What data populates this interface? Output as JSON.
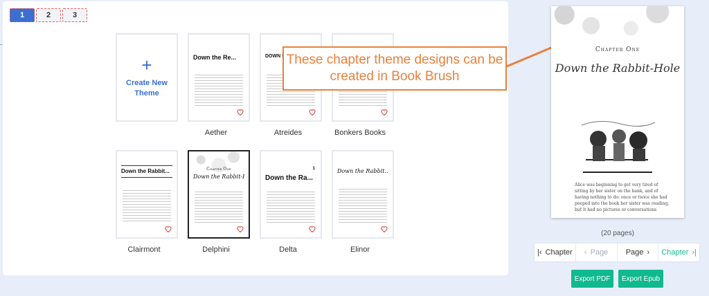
{
  "pagination": {
    "pages": [
      "1",
      "2",
      "3"
    ],
    "active": "1"
  },
  "themes": {
    "create_label": "Create New Theme",
    "create_plus": "+",
    "items": [
      {
        "name": "Aether",
        "title": "Down the Re..."
      },
      {
        "name": "Atreides",
        "title": "DOWN the"
      },
      {
        "name": "Bonkers Books",
        "title": ""
      },
      {
        "name": "Clairmont",
        "title": "Down the Rabbit..."
      },
      {
        "name": "Delphini",
        "chapter": "Chapter One",
        "title": "Down the Rabbit-Hole"
      },
      {
        "name": "Delta",
        "title": "Down the Ra...",
        "page": "1"
      },
      {
        "name": "Elinor",
        "title": "Down the Rabbit..."
      }
    ]
  },
  "callout": {
    "text": "These chapter theme designs can be created in Book Brush"
  },
  "preview": {
    "chapter": "Chapter One",
    "title": "Down the Rabbit-Hole",
    "body": "Alice was beginning to get very tired of sitting by her sister on the bank, and of having nothing to do: once or twice she had peeped into the book her sister was reading, but it had no pictures or conversations"
  },
  "page_count": "(20 pages)",
  "nav": {
    "prev_chapter": "Chapter",
    "prev_page": "Page",
    "next_page": "Page",
    "next_chapter": "Chapter"
  },
  "buttons": {
    "export_pdf": "Export PDF",
    "export_epub": "Export Epub"
  },
  "colors": {
    "accent_blue": "#3b6fd1",
    "accent_green": "#11b98f",
    "callout_orange": "#e8803b",
    "heart_red": "#e14b4b"
  },
  "icons": {
    "heart": "heart-icon",
    "chapter_prev": "double-chevron-left-icon",
    "page_prev": "chevron-left-icon",
    "page_next": "chevron-right-icon",
    "chapter_next": "double-chevron-right-icon"
  }
}
